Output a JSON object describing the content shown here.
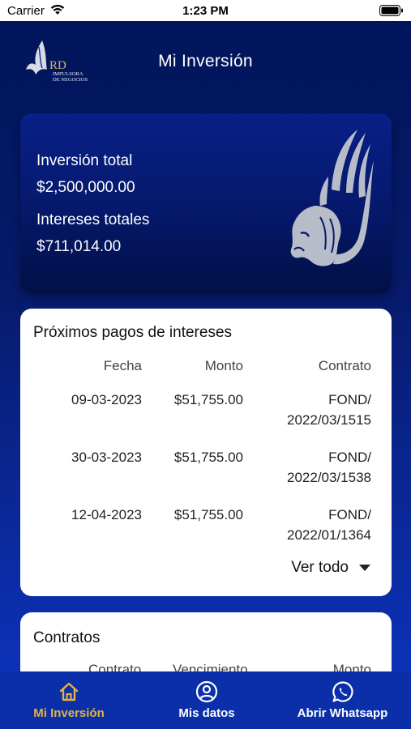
{
  "status_bar": {
    "carrier": "Carrier",
    "time": "1:23 PM"
  },
  "header": {
    "title": "Mi Inversión",
    "logo": {
      "mark": "RD",
      "line1": "IMPULSORA",
      "line2": "DE NEGOCIOS"
    }
  },
  "summary": {
    "total_investment_label": "Inversión total",
    "total_investment_value": "$2,500,000.00",
    "total_interest_label": "Intereses totales",
    "total_interest_value": "$711,014.00"
  },
  "payments": {
    "title": "Próximos pagos de intereses",
    "columns": [
      "Fecha",
      "Monto",
      "Contrato"
    ],
    "rows": [
      {
        "fecha": "09-03-2023",
        "monto": "$51,755.00",
        "contrato_1": "FOND/",
        "contrato_2": "2022/03/1515"
      },
      {
        "fecha": "30-03-2023",
        "monto": "$51,755.00",
        "contrato_1": "FOND/",
        "contrato_2": "2022/03/1538"
      },
      {
        "fecha": "12-04-2023",
        "monto": "$51,755.00",
        "contrato_1": "FOND/",
        "contrato_2": "2022/01/1364"
      }
    ],
    "see_all": "Ver todo"
  },
  "contracts": {
    "title": "Contratos",
    "columns": [
      "Contrato",
      "Vencimiento",
      "Monto"
    ]
  },
  "nav": {
    "items": [
      {
        "label": "Mi Inversión",
        "icon": "home-icon",
        "active": true
      },
      {
        "label": "Mis datos",
        "icon": "user-circle-icon",
        "active": false
      },
      {
        "label": "Abrir Whatsapp",
        "icon": "whatsapp-icon",
        "active": false
      }
    ]
  },
  "colors": {
    "active_nav": "#e3b341",
    "nav_bg": "#0a2fa8",
    "bg_top": "#00155a",
    "bg_bottom": "#0c35c4"
  }
}
